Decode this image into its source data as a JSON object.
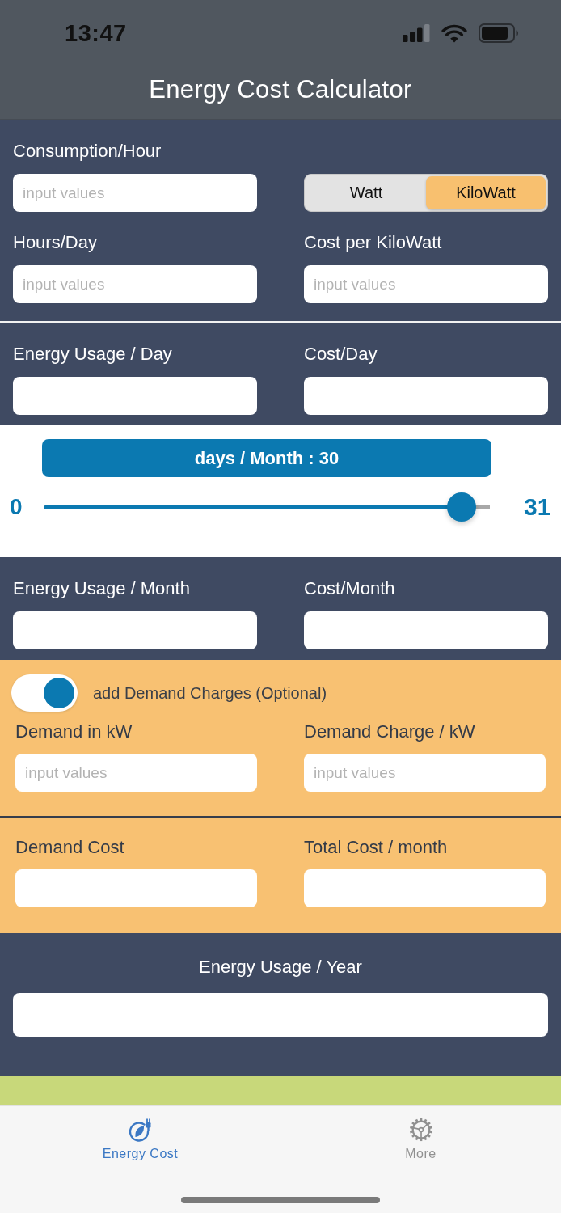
{
  "status_bar": {
    "time": "13:47"
  },
  "nav_bar": {
    "title": "Energy Cost Calculator"
  },
  "sections": [
    {
      "kind": "inputs",
      "items": [
        {
          "kind": "field",
          "label": "Consumption/Hour",
          "placeholder": "input values"
        },
        {
          "kind": "segmented",
          "segments": [
            {
              "label": "Watt",
              "selected": false
            },
            {
              "label": "KiloWatt",
              "selected": true
            }
          ]
        },
        {
          "kind": "field",
          "label": "Hours/Day",
          "placeholder": "input values"
        },
        {
          "kind": "field",
          "label": "Cost per KiloWatt",
          "placeholder": "input values"
        }
      ]
    },
    {
      "kind": "results",
      "items": [
        {
          "kind": "field",
          "label": "Energy Usage / Day"
        },
        {
          "kind": "field",
          "label": "Cost/Day"
        }
      ]
    },
    {
      "kind": "slider",
      "title": "days / Month : 30",
      "min_label": "0",
      "max_label": "31",
      "level": 0.968
    },
    {
      "kind": "results",
      "items": [
        {
          "kind": "field",
          "label": "Energy Usage / Month"
        },
        {
          "kind": "field",
          "label": "Cost/Month"
        }
      ]
    },
    {
      "kind": "demand",
      "items": [
        {
          "kind": "toggle",
          "label": "add Demand Charges (Optional)",
          "on": true
        },
        {
          "kind": "field",
          "label": "Demand in kW",
          "placeholder": "input values"
        },
        {
          "kind": "field",
          "label": "Demand Charge / kW",
          "placeholder": "input values"
        }
      ]
    },
    {
      "kind": "demand_results",
      "items": [
        {
          "kind": "field",
          "label": "Demand Cost"
        },
        {
          "kind": "field",
          "label": "Total Cost / month"
        }
      ]
    },
    {
      "kind": "yearly",
      "items": [
        {
          "kind": "field",
          "label": "Energy Usage / Year"
        }
      ]
    },
    {
      "kind": "banner"
    }
  ],
  "tab_bar": {
    "tabs": [
      {
        "label": "Energy Cost",
        "selected": true
      },
      {
        "label": "More",
        "selected": false
      }
    ]
  }
}
